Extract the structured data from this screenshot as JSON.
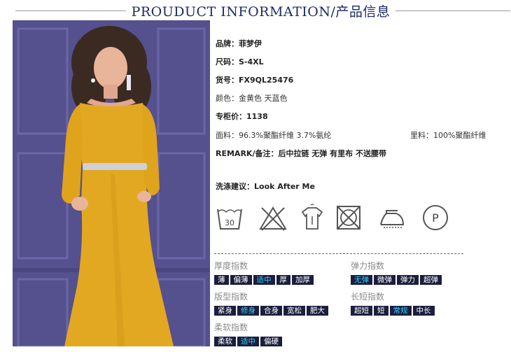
{
  "header": {
    "title": "PROUDUCT INFORMATION/产品信息"
  },
  "info": {
    "brand": "品牌：菲梦伊",
    "size": "尺码：S-4XL",
    "item_no": "货号：FX9QL25476",
    "color": "颜色：金黄色  天蓝色",
    "price": "专柜价：1138",
    "fabric": "面料：96.3%聚酯纤维 3.7%氨纶",
    "lining": "里料：100%聚酯纤维",
    "remark": "REMARK/备注：后中拉链 无弹 有里布 不送腰带",
    "washing": "洗涤建议：Look After Me"
  },
  "care_icons": [
    "wash-30-icon",
    "no-bleach-icon",
    "drip-dry-icon",
    "no-tumble-dry-icon",
    "iron-low-icon",
    "dry-clean-p-icon"
  ],
  "care_wash_temp": "30",
  "care_dry_clean_letter": "P",
  "indexes": {
    "thickness": {
      "title": "厚度指数",
      "options": [
        "薄",
        "偏薄",
        "适中",
        "厚",
        "加厚"
      ],
      "selected": "适中"
    },
    "elasticity": {
      "title": "弹力指数",
      "options": [
        "无弹",
        "微弹",
        "弹力",
        "超弹"
      ],
      "selected": "无弹"
    },
    "fit": {
      "title": "版型指数",
      "options": [
        "紧身",
        "修身",
        "合身",
        "宽松",
        "肥大"
      ],
      "selected": "修身"
    },
    "length": {
      "title": "长短指数",
      "options": [
        "超短",
        "短",
        "常规",
        "中长"
      ],
      "selected": "常规"
    },
    "softness": {
      "title": "柔软指数",
      "options": [
        "柔软",
        "适中",
        "偏硬"
      ],
      "selected": "适中"
    }
  },
  "colors": {
    "chip_bg": "#1b1e3e",
    "chip_active": "#2fd1ff",
    "title_blue": "#1d2b64",
    "dress_yellow": "#e3a821",
    "backdrop": "#55508e"
  }
}
